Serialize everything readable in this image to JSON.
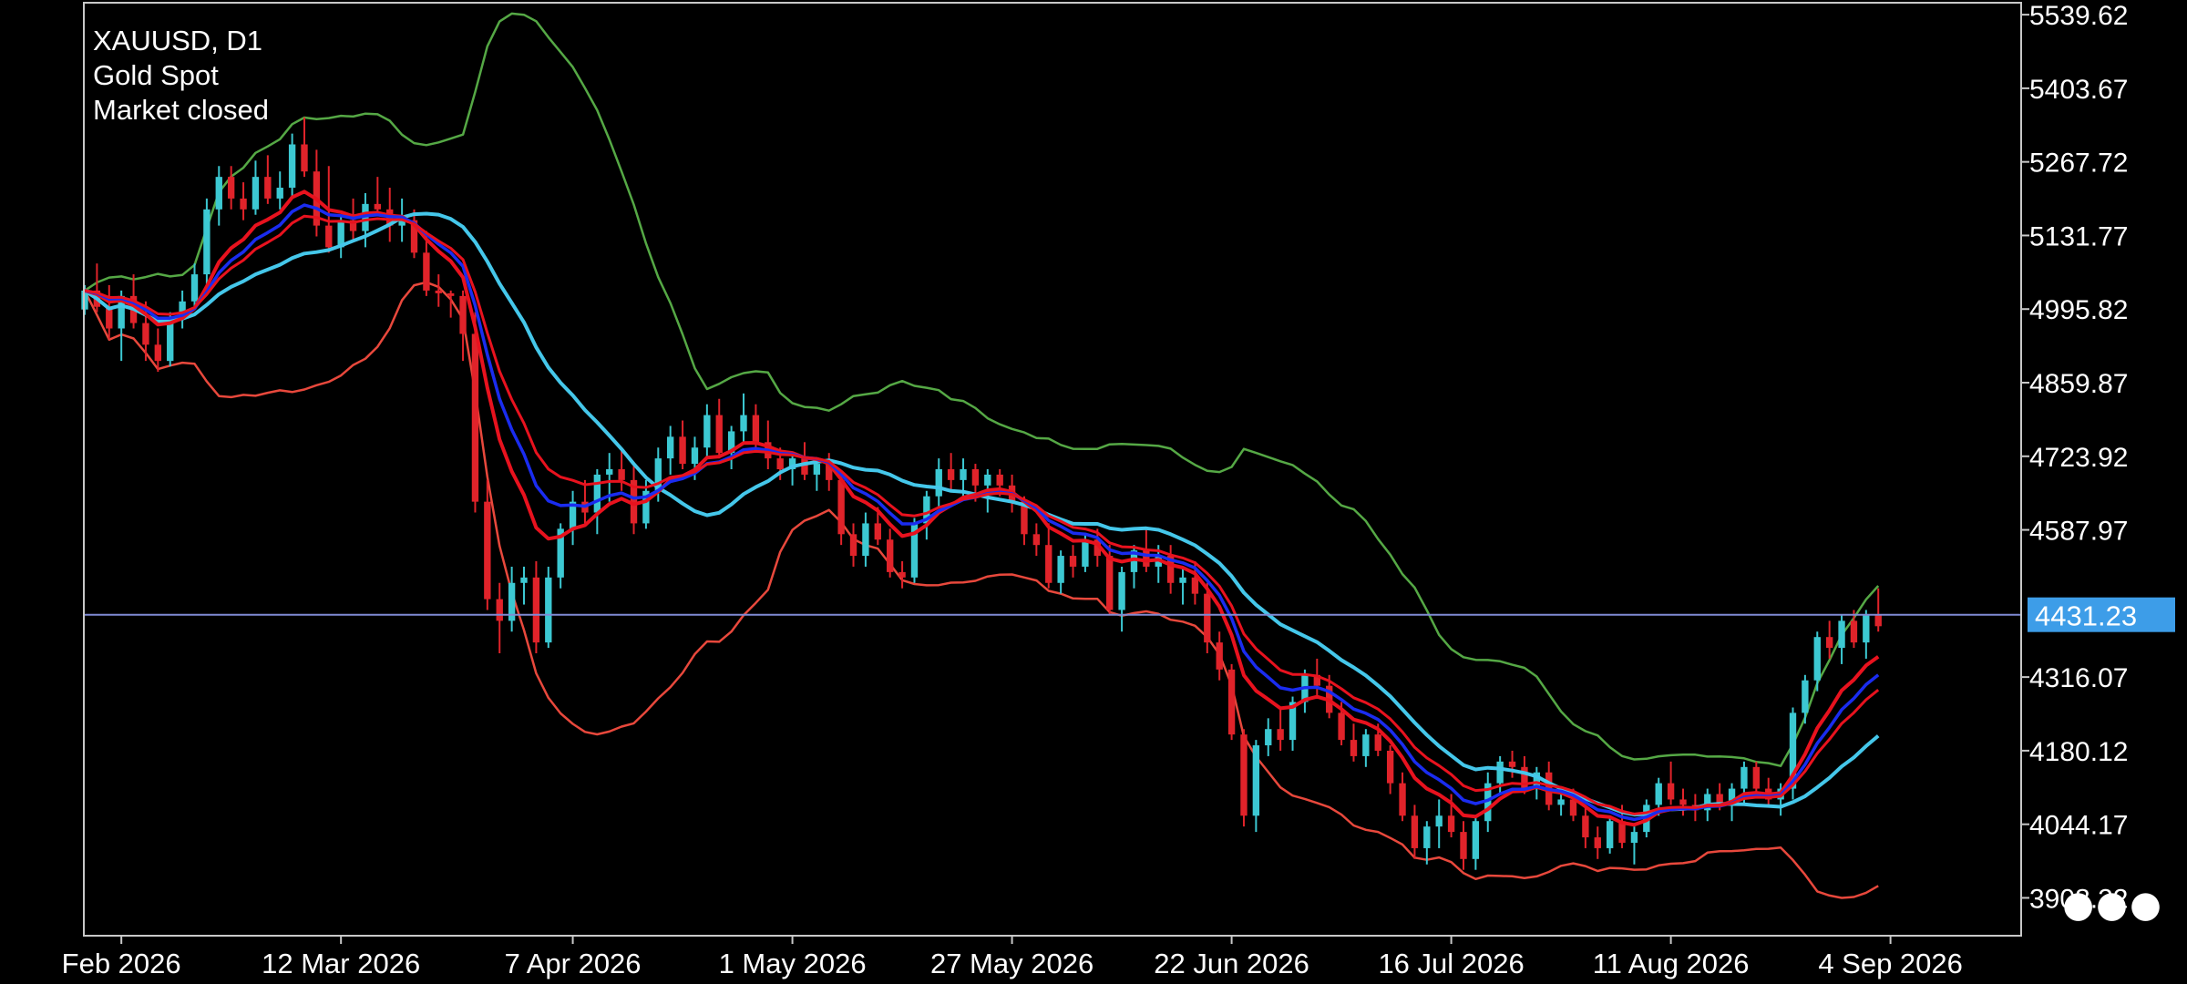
{
  "header": {
    "symbol_timeframe": "XAUUSD, D1",
    "description": "Gold Spot",
    "status": "Market closed"
  },
  "more_menu_icon": "ellipsis-icon",
  "colors": {
    "background": "#000000",
    "frame": "#c8c8c8",
    "bull_candle": "#3cc8d2",
    "bear_candle": "#e0232a",
    "ma_fast": "#e8121e",
    "ma_mid": "#1a2cf0",
    "ma_slow": "#45c7ea",
    "band_upper": "#55a845",
    "band_lower": "#e8483c",
    "price_line": "#7f8ad4",
    "price_label_bg": "#3d9de8"
  },
  "chart_data": {
    "type": "candlestick",
    "title": "XAUUSD, D1",
    "subtitle": "Gold Spot",
    "ylim": [
      3840,
      5560
    ],
    "y_ticks": [
      "5539.62",
      "5403.67",
      "5267.72",
      "5131.77",
      "4995.82",
      "4859.87",
      "4723.92",
      "4587.97",
      "4316.07",
      "4180.12",
      "4044.17",
      "3908.22"
    ],
    "x_ticks": [
      "Feb 2026",
      "12 Mar 2026",
      "7 Apr 2026",
      "1 May 2026",
      "27 May 2026",
      "22 Jun 2026",
      "16 Jul 2026",
      "11 Aug 2026",
      "4 Sep 2026"
    ],
    "x_tick_bars": [
      3,
      21,
      40,
      58,
      76,
      94,
      112,
      130,
      148
    ],
    "bar_count": 150,
    "current_price": "4431.23",
    "current_price_value": 4431.23,
    "candles": [
      [
        4995,
        5040,
        4985,
        5030
      ],
      [
        5030,
        5080,
        4990,
        5000
      ],
      [
        5000,
        5040,
        4940,
        4960
      ],
      [
        4960,
        5030,
        4900,
        5020
      ],
      [
        5020,
        5060,
        4960,
        4970
      ],
      [
        4970,
        5010,
        4900,
        4930
      ],
      [
        4930,
        4960,
        4880,
        4900
      ],
      [
        4900,
        4990,
        4890,
        4980
      ],
      [
        4980,
        5030,
        4960,
        5010
      ],
      [
        5010,
        5080,
        4995,
        5060
      ],
      [
        5060,
        5200,
        5040,
        5180
      ],
      [
        5180,
        5260,
        5150,
        5240
      ],
      [
        5240,
        5260,
        5180,
        5200
      ],
      [
        5200,
        5230,
        5160,
        5180
      ],
      [
        5180,
        5270,
        5170,
        5240
      ],
      [
        5240,
        5280,
        5190,
        5200
      ],
      [
        5200,
        5250,
        5180,
        5220
      ],
      [
        5220,
        5320,
        5200,
        5300
      ],
      [
        5300,
        5350,
        5240,
        5250
      ],
      [
        5250,
        5290,
        5130,
        5150
      ],
      [
        5150,
        5260,
        5100,
        5110
      ],
      [
        5110,
        5170,
        5090,
        5160
      ],
      [
        5160,
        5200,
        5120,
        5140
      ],
      [
        5140,
        5210,
        5110,
        5190
      ],
      [
        5190,
        5240,
        5170,
        5180
      ],
      [
        5180,
        5220,
        5120,
        5150
      ],
      [
        5150,
        5200,
        5120,
        5160
      ],
      [
        5160,
        5180,
        5090,
        5100
      ],
      [
        5100,
        5140,
        5020,
        5030
      ],
      [
        5030,
        5060,
        5000,
        5025
      ],
      [
        5025,
        5030,
        4980,
        5020
      ],
      [
        5020,
        5030,
        4900,
        4950
      ],
      [
        4950,
        4990,
        4620,
        4640
      ],
      [
        4640,
        4680,
        4440,
        4460
      ],
      [
        4460,
        4490,
        4360,
        4420
      ],
      [
        4420,
        4520,
        4400,
        4490
      ],
      [
        4490,
        4520,
        4450,
        4500
      ],
      [
        4500,
        4530,
        4360,
        4380
      ],
      [
        4380,
        4520,
        4370,
        4500
      ],
      [
        4500,
        4600,
        4480,
        4590
      ],
      [
        4590,
        4660,
        4560,
        4640
      ],
      [
        4640,
        4680,
        4600,
        4620
      ],
      [
        4620,
        4700,
        4580,
        4690
      ],
      [
        4690,
        4730,
        4640,
        4700
      ],
      [
        4700,
        4740,
        4660,
        4680
      ],
      [
        4680,
        4710,
        4580,
        4600
      ],
      [
        4600,
        4680,
        4590,
        4660
      ],
      [
        4660,
        4740,
        4640,
        4720
      ],
      [
        4720,
        4780,
        4690,
        4760
      ],
      [
        4760,
        4790,
        4700,
        4710
      ],
      [
        4710,
        4760,
        4680,
        4740
      ],
      [
        4740,
        4820,
        4720,
        4800
      ],
      [
        4800,
        4830,
        4720,
        4730
      ],
      [
        4730,
        4780,
        4700,
        4770
      ],
      [
        4770,
        4840,
        4750,
        4800
      ],
      [
        4800,
        4820,
        4740,
        4750
      ],
      [
        4750,
        4790,
        4700,
        4720
      ],
      [
        4720,
        4740,
        4680,
        4700
      ],
      [
        4700,
        4730,
        4670,
        4720
      ],
      [
        4720,
        4750,
        4680,
        4690
      ],
      [
        4690,
        4720,
        4660,
        4710
      ],
      [
        4710,
        4730,
        4660,
        4680
      ],
      [
        4680,
        4690,
        4560,
        4580
      ],
      [
        4580,
        4600,
        4520,
        4540
      ],
      [
        4540,
        4620,
        4520,
        4600
      ],
      [
        4600,
        4630,
        4560,
        4570
      ],
      [
        4570,
        4590,
        4500,
        4510
      ],
      [
        4510,
        4530,
        4480,
        4500
      ],
      [
        4500,
        4610,
        4490,
        4600
      ],
      [
        4600,
        4660,
        4570,
        4650
      ],
      [
        4650,
        4720,
        4630,
        4700
      ],
      [
        4700,
        4730,
        4660,
        4680
      ],
      [
        4680,
        4720,
        4650,
        4700
      ],
      [
        4700,
        4710,
        4640,
        4670
      ],
      [
        4670,
        4700,
        4620,
        4690
      ],
      [
        4690,
        4700,
        4650,
        4670
      ],
      [
        4670,
        4690,
        4620,
        4640
      ],
      [
        4640,
        4650,
        4560,
        4580
      ],
      [
        4580,
        4600,
        4540,
        4560
      ],
      [
        4560,
        4600,
        4480,
        4490
      ],
      [
        4490,
        4550,
        4470,
        4540
      ],
      [
        4540,
        4560,
        4500,
        4520
      ],
      [
        4520,
        4580,
        4510,
        4570
      ],
      [
        4570,
        4590,
        4520,
        4540
      ],
      [
        4540,
        4560,
        4430,
        4440
      ],
      [
        4440,
        4520,
        4400,
        4510
      ],
      [
        4510,
        4560,
        4480,
        4550
      ],
      [
        4550,
        4590,
        4510,
        4520
      ],
      [
        4520,
        4560,
        4490,
        4540
      ],
      [
        4540,
        4560,
        4470,
        4490
      ],
      [
        4490,
        4520,
        4450,
        4500
      ],
      [
        4500,
        4530,
        4450,
        4470
      ],
      [
        4470,
        4490,
        4360,
        4380
      ],
      [
        4380,
        4400,
        4310,
        4330
      ],
      [
        4330,
        4340,
        4200,
        4210
      ],
      [
        4210,
        4220,
        4040,
        4060
      ],
      [
        4060,
        4200,
        4030,
        4190
      ],
      [
        4190,
        4240,
        4170,
        4220
      ],
      [
        4220,
        4260,
        4180,
        4200
      ],
      [
        4200,
        4280,
        4180,
        4270
      ],
      [
        4270,
        4330,
        4250,
        4320
      ],
      [
        4320,
        4350,
        4280,
        4300
      ],
      [
        4300,
        4320,
        4240,
        4250
      ],
      [
        4250,
        4270,
        4190,
        4200
      ],
      [
        4200,
        4230,
        4160,
        4170
      ],
      [
        4170,
        4220,
        4150,
        4210
      ],
      [
        4210,
        4230,
        4170,
        4180
      ],
      [
        4180,
        4190,
        4100,
        4120
      ],
      [
        4120,
        4140,
        4050,
        4060
      ],
      [
        4060,
        4080,
        3980,
        4000
      ],
      [
        4000,
        4050,
        3970,
        4040
      ],
      [
        4040,
        4090,
        4000,
        4060
      ],
      [
        4060,
        4100,
        4020,
        4030
      ],
      [
        4030,
        4050,
        3960,
        3980
      ],
      [
        3980,
        4060,
        3960,
        4050
      ],
      [
        4050,
        4140,
        4030,
        4120
      ],
      [
        4120,
        4170,
        4100,
        4160
      ],
      [
        4160,
        4180,
        4130,
        4150
      ],
      [
        4150,
        4170,
        4100,
        4110
      ],
      [
        4110,
        4150,
        4090,
        4140
      ],
      [
        4140,
        4160,
        4070,
        4080
      ],
      [
        4080,
        4100,
        4060,
        4090
      ],
      [
        4090,
        4110,
        4050,
        4060
      ],
      [
        4060,
        4080,
        4000,
        4020
      ],
      [
        4020,
        4040,
        3980,
        4000
      ],
      [
        4000,
        4060,
        3990,
        4050
      ],
      [
        4050,
        4080,
        4000,
        4010
      ],
      [
        4010,
        4040,
        3970,
        4030
      ],
      [
        4030,
        4090,
        4020,
        4080
      ],
      [
        4080,
        4130,
        4060,
        4120
      ],
      [
        4120,
        4160,
        4080,
        4090
      ],
      [
        4090,
        4110,
        4060,
        4080
      ],
      [
        4080,
        4100,
        4050,
        4070
      ],
      [
        4070,
        4110,
        4050,
        4100
      ],
      [
        4100,
        4120,
        4070,
        4080
      ],
      [
        4080,
        4120,
        4050,
        4110
      ],
      [
        4110,
        4160,
        4080,
        4150
      ],
      [
        4150,
        4160,
        4100,
        4110
      ],
      [
        4110,
        4130,
        4080,
        4090
      ],
      [
        4090,
        4120,
        4060,
        4110
      ],
      [
        4110,
        4260,
        4090,
        4250
      ],
      [
        4250,
        4320,
        4230,
        4310
      ],
      [
        4310,
        4400,
        4290,
        4390
      ],
      [
        4390,
        4420,
        4350,
        4370
      ],
      [
        4370,
        4430,
        4340,
        4420
      ],
      [
        4420,
        4440,
        4370,
        4380
      ],
      [
        4380,
        4440,
        4350,
        4430
      ],
      [
        4430,
        4480,
        4400,
        4410
      ]
    ]
  }
}
